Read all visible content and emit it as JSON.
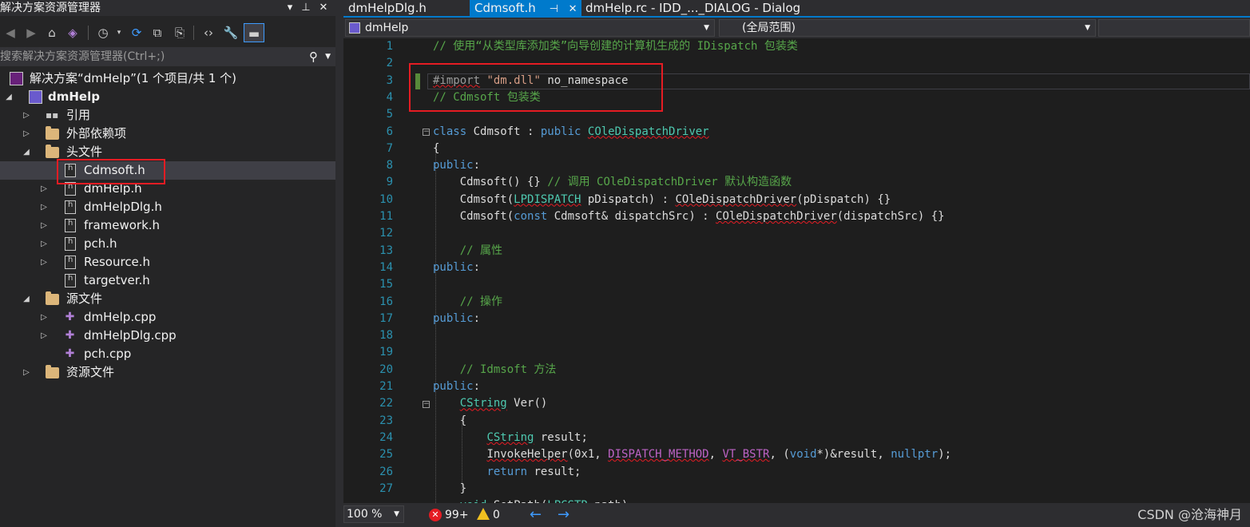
{
  "explorer": {
    "title": "解决方案资源管理器",
    "pin_glyph": "▼ ᵖ",
    "close_glyph": "✕",
    "search_placeholder": "搜索解决方案资源管理器(Ctrl+;)",
    "solution": "解决方案“dmHelp”(1 个项目/共 1 个)",
    "project": "dmHelp",
    "items": [
      {
        "label": "引用"
      },
      {
        "label": "外部依赖项"
      },
      {
        "label": "头文件"
      },
      {
        "label": "Cdmsoft.h"
      },
      {
        "label": "dmHelp.h"
      },
      {
        "label": "dmHelpDlg.h"
      },
      {
        "label": "framework.h"
      },
      {
        "label": "pch.h"
      },
      {
        "label": "Resource.h"
      },
      {
        "label": "targetver.h"
      },
      {
        "label": "源文件"
      },
      {
        "label": "dmHelp.cpp"
      },
      {
        "label": "dmHelpDlg.cpp"
      },
      {
        "label": "pch.cpp"
      },
      {
        "label": "资源文件"
      }
    ]
  },
  "tabs": [
    {
      "label": "dmHelpDlg.h"
    },
    {
      "label": "Cdmsoft.h"
    },
    {
      "label": "dmHelp.rc - IDD_..._DIALOG - Dialog"
    }
  ],
  "nav": {
    "project": "dmHelp",
    "scope": "(全局范围)"
  },
  "line_numbers": [
    "1",
    "2",
    "3",
    "4",
    "5",
    "6",
    "7",
    "8",
    "9",
    "10",
    "11",
    "12",
    "13",
    "14",
    "15",
    "16",
    "17",
    "18",
    "19",
    "20",
    "21",
    "22",
    "23",
    "24",
    "25",
    "26",
    "27"
  ],
  "status": {
    "zoom": "100 %",
    "errors": "99+",
    "warnings": "0",
    "watermark": "CSDN @沧海神月"
  },
  "colors": {
    "accent": "#007acc",
    "highlight_box": "#e51c23",
    "comment": "#57a64a",
    "keyword": "#569cd6"
  }
}
